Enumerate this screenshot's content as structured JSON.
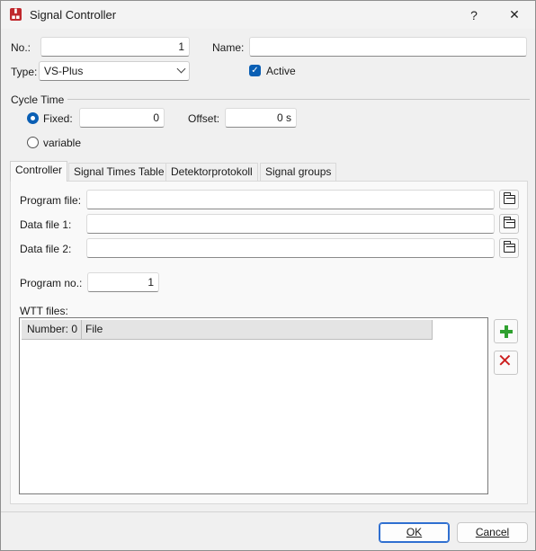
{
  "window": {
    "title": "Signal Controller",
    "help_label": "?",
    "close_label": "✕"
  },
  "header": {
    "no_label": "No.:",
    "no_value": "1",
    "name_label": "Name:",
    "name_value": "",
    "type_label": "Type:",
    "type_value": "VS-Plus",
    "active_label": "Active",
    "active_checked": true
  },
  "cycle": {
    "group_label": "Cycle Time",
    "fixed_label": "Fixed:",
    "fixed_value": "0",
    "offset_label": "Offset:",
    "offset_value": "0 s",
    "variable_label": "variable",
    "selected": "fixed"
  },
  "tabs": [
    {
      "label": "Controller",
      "active": true
    },
    {
      "label": "Signal Times Table",
      "active": false
    },
    {
      "label": "Detektorprotokoll",
      "active": false
    },
    {
      "label": "Signal groups",
      "active": false
    }
  ],
  "controller": {
    "program_file_label": "Program file:",
    "program_file_value": "",
    "data_file1_label": "Data file 1:",
    "data_file1_value": "",
    "data_file2_label": "Data file 2:",
    "data_file2_value": "",
    "program_no_label": "Program no.:",
    "program_no_value": "1",
    "wtt_label": "WTT files:",
    "wtt_columns": [
      "Number: 0",
      "File"
    ],
    "wtt_rows": []
  },
  "buttons": {
    "ok_label": "OK",
    "cancel_label": "Cancel"
  },
  "icons": [
    "app-icon",
    "help-icon",
    "close-icon",
    "checkbox-icon",
    "folder-icon",
    "add-icon",
    "delete-icon"
  ],
  "colors": {
    "accent": "#0a5fb4",
    "add_green": "#2fa02f",
    "delete_red": "#cc1f1f",
    "app_icon_red": "#c0282d"
  }
}
